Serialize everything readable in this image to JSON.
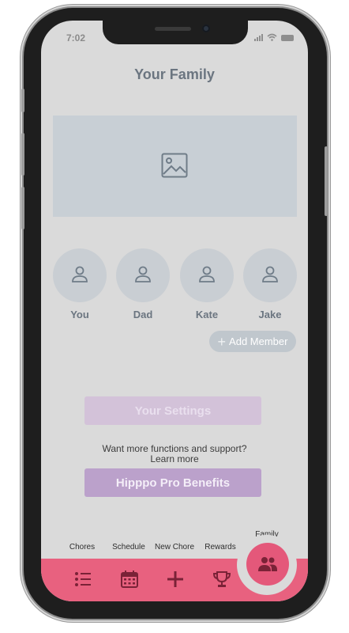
{
  "status_bar": {
    "time": "7:02"
  },
  "page": {
    "title": "Your Family"
  },
  "members": [
    {
      "name": "You"
    },
    {
      "name": "Dad"
    },
    {
      "name": "Kate"
    },
    {
      "name": "Jake"
    }
  ],
  "add_member": {
    "label": "Add Member"
  },
  "settings": {
    "label": "Your Settings"
  },
  "promo": {
    "line1": "Want more functions and support?",
    "line2": "Learn more"
  },
  "pro": {
    "label": "Hipppo Pro Benefits"
  },
  "tabs": [
    {
      "label": "Chores",
      "icon": "checklist-icon"
    },
    {
      "label": "Schedule",
      "icon": "calendar-icon"
    },
    {
      "label": "New Chore",
      "icon": "plus-icon"
    },
    {
      "label": "Rewards",
      "icon": "trophy-icon"
    },
    {
      "label": "Family",
      "icon": "people-icon",
      "active": true
    }
  ],
  "colors": {
    "accent": "#e8617f",
    "pro": "#bba1cb",
    "settings": "#d3c2d9",
    "background": "#dadada"
  }
}
